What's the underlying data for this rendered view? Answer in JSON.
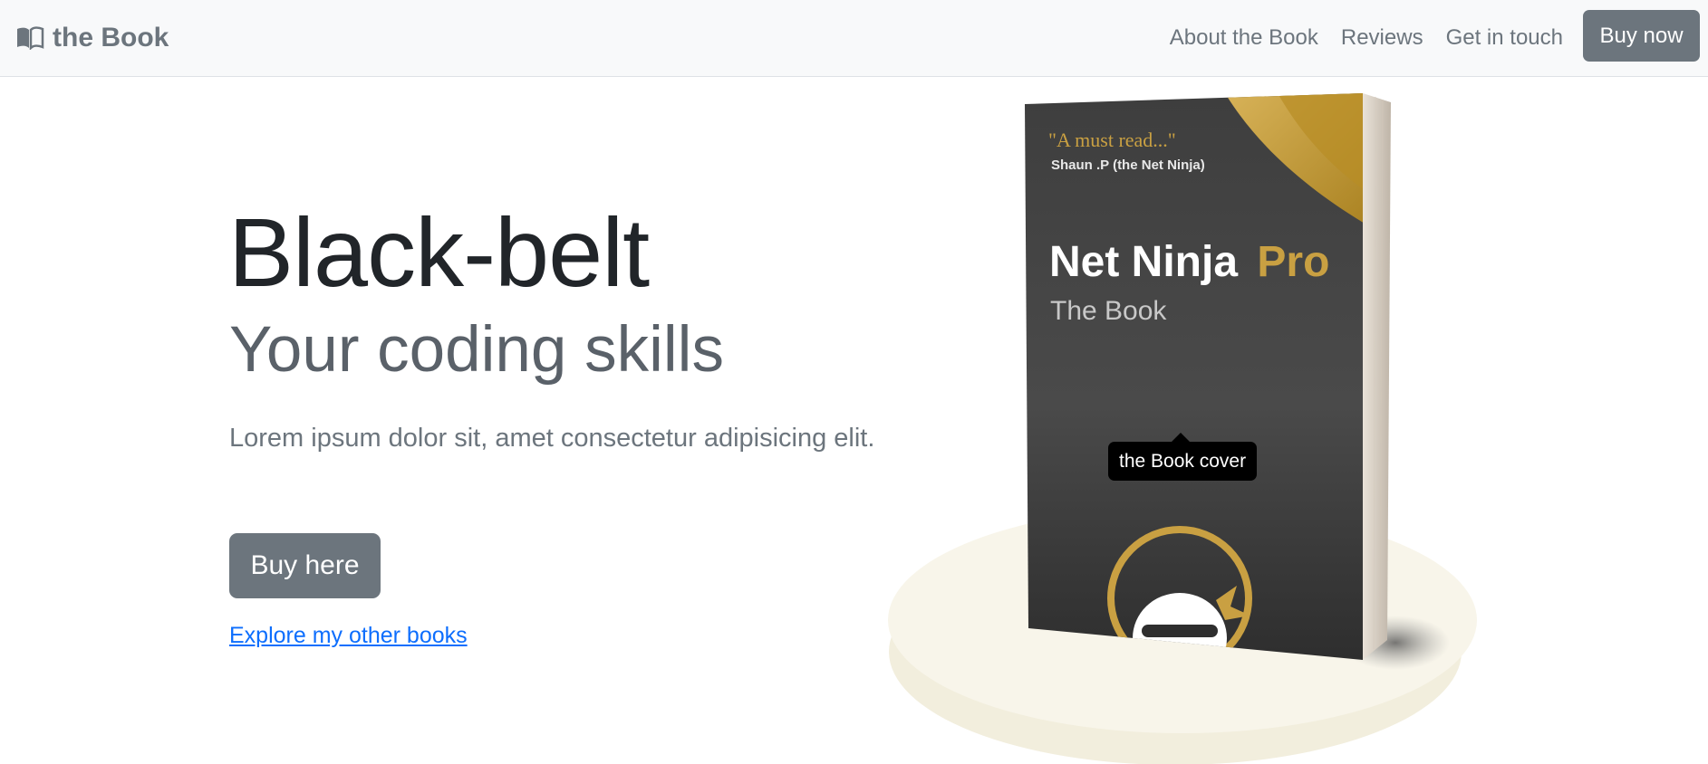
{
  "navbar": {
    "brand": {
      "icon": "book-open-icon",
      "text": "the Book"
    },
    "links": [
      "About the Book",
      "Reviews",
      "Get in touch"
    ],
    "cta": "Buy now"
  },
  "hero": {
    "title": "Black-belt",
    "subtitle": "Your coding skills",
    "lead": "Lorem ipsum dolor sit, amet consectetur adipisicing elit.",
    "button": "Buy here",
    "link": "Explore my other books"
  },
  "book": {
    "quote": "\"A must read...\"",
    "quote_author": "Shaun .P (the Net Ninja)",
    "title_main": "Net Ninja",
    "title_accent": "Pro",
    "subtitle": "The Book",
    "tooltip": "the Book cover"
  },
  "colors": {
    "secondary": "#6c757d",
    "link": "#0d6efd",
    "navbar_bg": "#f8f9fa",
    "cover_dark": "#3a3a3a",
    "cover_gold": "#c9a042",
    "pedestal": "#f7f4e8"
  }
}
